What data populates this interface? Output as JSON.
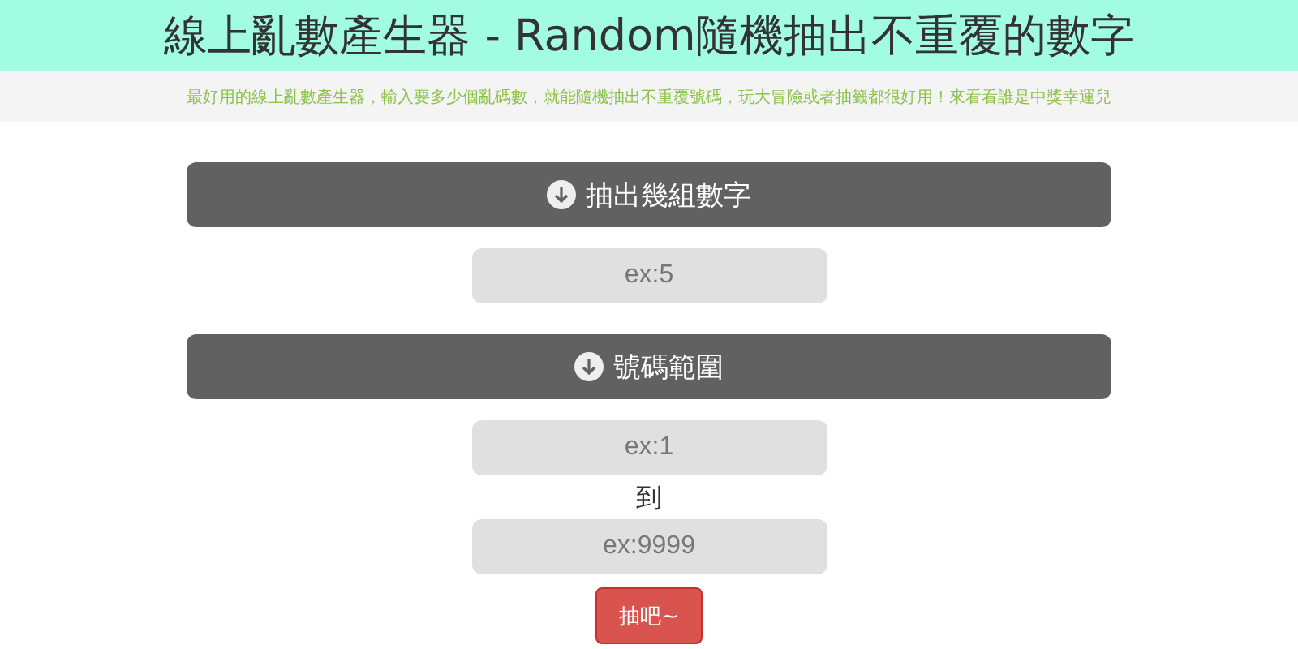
{
  "header": {
    "title": "線上亂數產生器 - Random隨機抽出不重覆的數字"
  },
  "tagline": "最好用的線上亂數產生器，輸入要多少個亂碼數，就能隨機抽出不重覆號碼，玩大冒險或者抽籤都很好用！來看看誰是中獎幸運兒",
  "sections": [
    {
      "heading": "抽出幾組數字",
      "items": [
        {
          "kind": "field",
          "placeholder": "ex:5"
        }
      ]
    },
    {
      "heading": "號碼範圍",
      "items": [
        {
          "kind": "field",
          "placeholder": "ex:1"
        },
        {
          "kind": "text",
          "text": "到"
        },
        {
          "kind": "field",
          "placeholder": "ex:9999"
        }
      ]
    }
  ],
  "submit": {
    "label": "抽吧~"
  }
}
